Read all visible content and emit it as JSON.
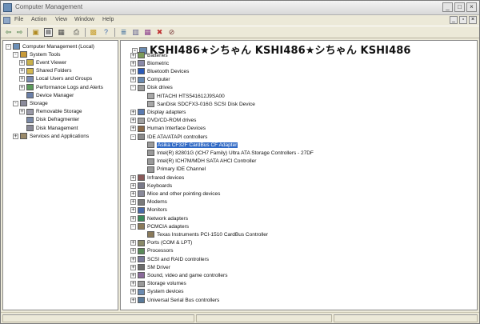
{
  "window": {
    "title": "Computer Management"
  },
  "menu": [
    "File",
    "Action",
    "View",
    "Window",
    "Help"
  ],
  "toolbar": {
    "icons": [
      "back-icon",
      "forward-icon",
      "up-folder-icon",
      "show-hide-tree-icon",
      "refresh-icon",
      "print-icon",
      "export-list-icon",
      "help-icon",
      "properties-icon",
      "scan-hardware-icon",
      "update-driver-icon",
      "uninstall-icon",
      "disable-icon"
    ]
  },
  "tree": [
    {
      "label": "Computer Management (Local)",
      "level": 0,
      "exp": "-",
      "color": "#6b8fb8"
    },
    {
      "label": "System Tools",
      "level": 1,
      "exp": "-",
      "color": "#c89a3a"
    },
    {
      "label": "Event Viewer",
      "level": 2,
      "exp": "+",
      "color": "#c8b04a"
    },
    {
      "label": "Shared Folders",
      "level": 2,
      "exp": "+",
      "color": "#d4b850"
    },
    {
      "label": "Local Users and Groups",
      "level": 2,
      "exp": "+",
      "color": "#7a8ab0"
    },
    {
      "label": "Performance Logs and Alerts",
      "level": 2,
      "exp": "+",
      "color": "#5a9a5a"
    },
    {
      "label": "Device Manager",
      "level": 2,
      "exp": "",
      "color": "#6a7fa8"
    },
    {
      "label": "Storage",
      "level": 1,
      "exp": "-",
      "color": "#8a8a9a"
    },
    {
      "label": "Removable Storage",
      "level": 2,
      "exp": "+",
      "color": "#9a9aa8"
    },
    {
      "label": "Disk Defragmenter",
      "level": 2,
      "exp": "",
      "color": "#7a8aa8"
    },
    {
      "label": "Disk Management",
      "level": 2,
      "exp": "",
      "color": "#8a8a98"
    },
    {
      "label": "Services and Applications",
      "level": 1,
      "exp": "+",
      "color": "#9a8a6a"
    }
  ],
  "devices": {
    "root": "KSHI486★シちゃん KSHI486★シちゃん KSHI486",
    "items": [
      {
        "label": "Batteries",
        "level": 0,
        "exp": "+",
        "color": "#7a9a5a"
      },
      {
        "label": "Biometric",
        "level": 0,
        "exp": "+",
        "color": "#8a8aa8"
      },
      {
        "label": "Bluetooth Devices",
        "level": 0,
        "exp": "+",
        "color": "#2a5ab8"
      },
      {
        "label": "Computer",
        "level": 0,
        "exp": "+",
        "color": "#6a8ab0"
      },
      {
        "label": "Disk drives",
        "level": 0,
        "exp": "-",
        "color": "#9a9a9a"
      },
      {
        "label": "HITACHI HTS541612J9SA00",
        "level": 1,
        "exp": "",
        "color": "#a8a8a8"
      },
      {
        "label": "SanDisk SDCFX3-016G SCSI Disk Device",
        "level": 1,
        "exp": "",
        "color": "#a8a8a8"
      },
      {
        "label": "Display adapters",
        "level": 0,
        "exp": "+",
        "color": "#5a7ab0"
      },
      {
        "label": "DVD/CD-ROM drives",
        "level": 0,
        "exp": "+",
        "color": "#a0a0a0"
      },
      {
        "label": "Human Interface Devices",
        "level": 0,
        "exp": "+",
        "color": "#8a6a4a"
      },
      {
        "label": "IDE ATA/ATAPI controllers",
        "level": 0,
        "exp": "-",
        "color": "#8a8a8a"
      },
      {
        "label": "Asika CF32F CardBus CF Adapter",
        "level": 1,
        "exp": "",
        "color": "#9a9a9a",
        "selected": true
      },
      {
        "label": "Intel(R) 82801G (ICH7 Family) Ultra ATA Storage Controllers - 27DF",
        "level": 1,
        "exp": "",
        "color": "#9a9a9a"
      },
      {
        "label": "Intel(R) ICH7M/MDH SATA AHCI Controller",
        "level": 1,
        "exp": "",
        "color": "#9a9a9a"
      },
      {
        "label": "Primary IDE Channel",
        "level": 1,
        "exp": "",
        "color": "#9a9a9a"
      },
      {
        "label": "Infrared devices",
        "level": 0,
        "exp": "+",
        "color": "#8a5a5a"
      },
      {
        "label": "Keyboards",
        "level": 0,
        "exp": "+",
        "color": "#7a7a8a"
      },
      {
        "label": "Mice and other pointing devices",
        "level": 0,
        "exp": "+",
        "color": "#8a8a9a"
      },
      {
        "label": "Modems",
        "level": 0,
        "exp": "+",
        "color": "#7a7a7a"
      },
      {
        "label": "Monitors",
        "level": 0,
        "exp": "+",
        "color": "#4a6aa8"
      },
      {
        "label": "Network adapters",
        "level": 0,
        "exp": "+",
        "color": "#3a8a5a"
      },
      {
        "label": "PCMCIA adapters",
        "level": 0,
        "exp": "-",
        "color": "#8a7a5a"
      },
      {
        "label": "Texas Instruments PCI-1510 CardBus Controller",
        "level": 1,
        "exp": "",
        "color": "#8a7a5a"
      },
      {
        "label": "Ports (COM & LPT)",
        "level": 0,
        "exp": "+",
        "color": "#8a8a6a"
      },
      {
        "label": "Processors",
        "level": 0,
        "exp": "+",
        "color": "#5a8a5a"
      },
      {
        "label": "SCSI and RAID controllers",
        "level": 0,
        "exp": "+",
        "color": "#7a7a9a"
      },
      {
        "label": "SM Driver",
        "level": 0,
        "exp": "+",
        "color": "#6a6a6a"
      },
      {
        "label": "Sound, video and game controllers",
        "level": 0,
        "exp": "+",
        "color": "#8a6a9a"
      },
      {
        "label": "Storage volumes",
        "level": 0,
        "exp": "+",
        "color": "#9a9a9a"
      },
      {
        "label": "System devices",
        "level": 0,
        "exp": "+",
        "color": "#6a8ab0"
      },
      {
        "label": "Universal Serial Bus controllers",
        "level": 0,
        "exp": "+",
        "color": "#5a7a9a"
      }
    ]
  }
}
